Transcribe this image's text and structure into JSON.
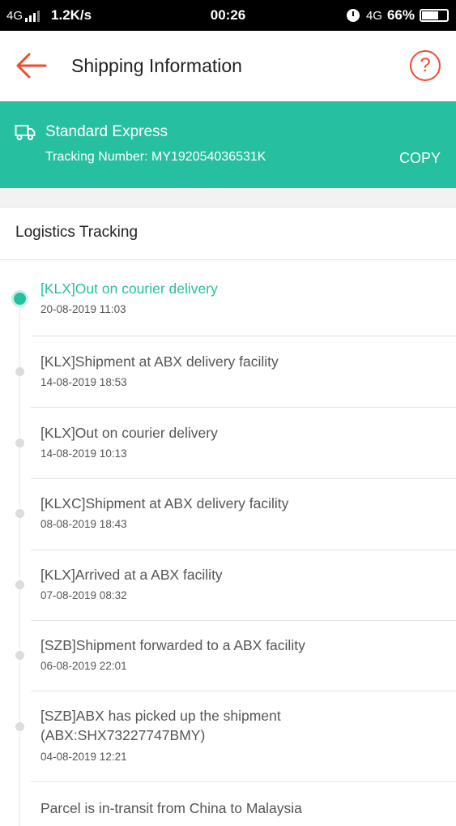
{
  "status_bar": {
    "network": "4G",
    "speed": "1.2K/s",
    "time": "00:26",
    "network_right": "4G",
    "battery": "66%"
  },
  "header": {
    "title": "Shipping Information",
    "back_icon": "arrow-left-icon",
    "help_icon": "question-circle-icon",
    "help_glyph": "?"
  },
  "banner": {
    "icon": "truck-icon",
    "method": "Standard Express",
    "tracking_number": "Tracking Number: MY192054036531K",
    "copy_label": "COPY"
  },
  "logistics": {
    "title": "Logistics Tracking",
    "events": [
      {
        "title": "[KLX]Out on courier delivery",
        "time": "20-08-2019 11:03",
        "active": true
      },
      {
        "title": "[KLX]Shipment at ABX delivery facility",
        "time": "14-08-2019 18:53"
      },
      {
        "title": "[KLX]Out on courier delivery",
        "time": "14-08-2019 10:13"
      },
      {
        "title": "[KLXC]Shipment at ABX delivery facility",
        "time": "08-08-2019 18:43"
      },
      {
        "title": "[KLX]Arrived at a ABX facility",
        "time": "07-08-2019 08:32"
      },
      {
        "title": "[SZB]Shipment forwarded to a ABX facility",
        "time": "06-08-2019 22:01"
      },
      {
        "title": "[SZB]ABX has picked up the shipment (ABX:SHX73227747BMY)",
        "time": "04-08-2019 12:21"
      },
      {
        "title": "Parcel is in-transit from China to Malaysia",
        "time": ""
      }
    ]
  },
  "colors": {
    "accent": "#ee4d2d",
    "teal": "#26bfa0"
  }
}
